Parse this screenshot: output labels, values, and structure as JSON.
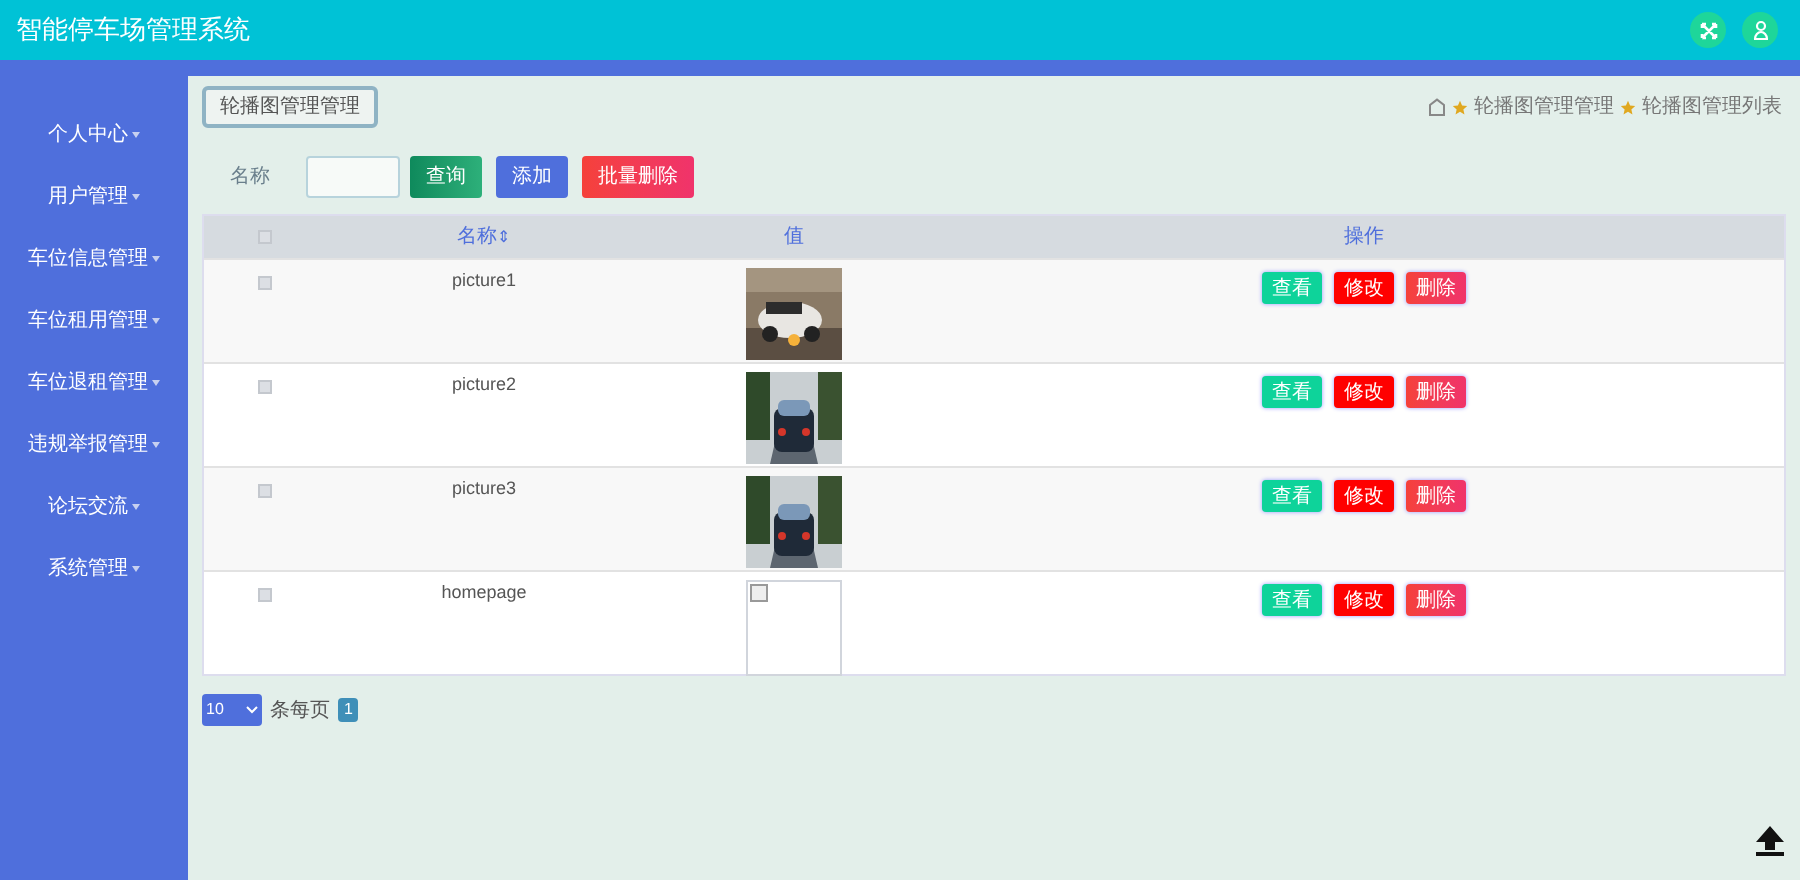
{
  "header": {
    "title": "智能停车场管理系统"
  },
  "sidebar": {
    "items": [
      "个人中心",
      "用户管理",
      "车位信息管理",
      "车位租用管理",
      "车位退租管理",
      "违规举报管理",
      "论坛交流",
      "系统管理"
    ]
  },
  "page_tab": "轮播图管理管理",
  "breadcrumb": [
    "轮播图管理管理",
    "轮播图管理列表"
  ],
  "search": {
    "label": "名称"
  },
  "toolbar": [
    {
      "label": "查询",
      "kind": "search"
    },
    {
      "label": "添加",
      "kind": "add"
    },
    {
      "label": "批量删除",
      "kind": "delete"
    }
  ],
  "table": {
    "select_all": {
      "checked": false
    },
    "columns": [
      {
        "label": "名称",
        "sort": "⇕"
      },
      {
        "label": "值"
      },
      {
        "label": "操作"
      }
    ],
    "rows": [
      {
        "checked": false,
        "name": "picture1",
        "image": {
          "kind": "picture"
        },
        "actions": [
          {
            "label": "查看",
            "kind": "view"
          },
          {
            "label": "修改",
            "kind": "edit"
          },
          {
            "label": "删除",
            "kind": "delete"
          }
        ]
      },
      {
        "checked": false,
        "name": "picture2",
        "image": {
          "kind": "picture"
        },
        "actions": [
          {
            "label": "查看",
            "kind": "view"
          },
          {
            "label": "修改",
            "kind": "edit"
          },
          {
            "label": "删除",
            "kind": "delete"
          }
        ]
      },
      {
        "checked": false,
        "name": "picture3",
        "image": {
          "kind": "picture"
        },
        "actions": [
          {
            "label": "查看",
            "kind": "view"
          },
          {
            "label": "修改",
            "kind": "edit"
          },
          {
            "label": "删除",
            "kind": "delete"
          }
        ]
      },
      {
        "checked": false,
        "name": "homepage",
        "image": {
          "kind": "broken"
        },
        "actions": [
          {
            "label": "查看",
            "kind": "view"
          },
          {
            "label": "修改",
            "kind": "edit"
          },
          {
            "label": "删除",
            "kind": "delete"
          }
        ]
      }
    ]
  },
  "pagination": {
    "page_size": "10",
    "label": "条每页",
    "current": "1"
  }
}
